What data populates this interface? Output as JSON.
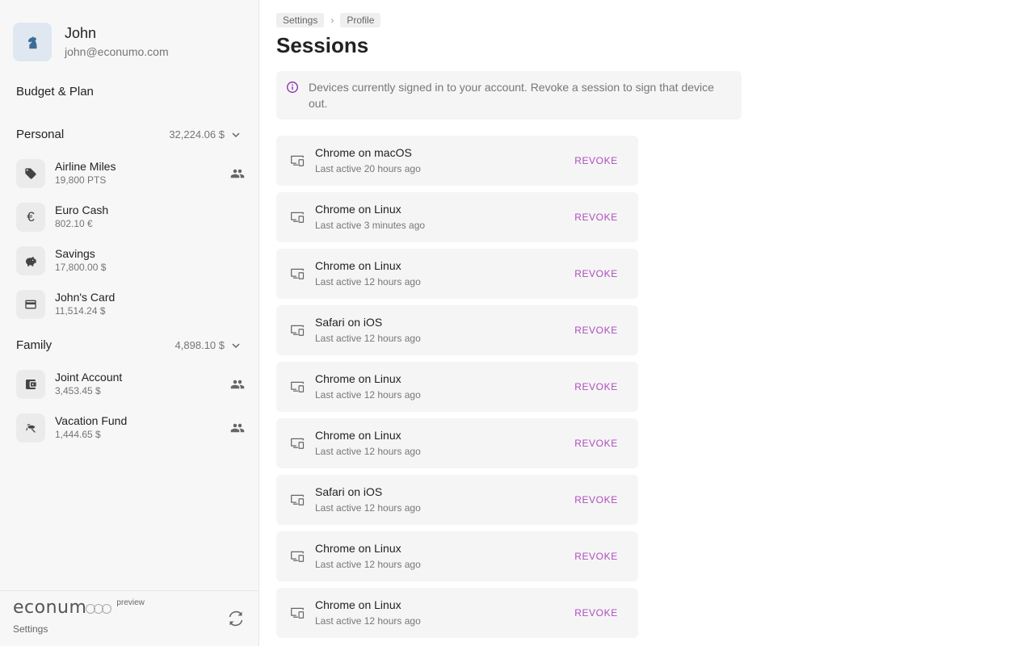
{
  "user": {
    "name": "John",
    "email": "john@econumo.com"
  },
  "sidebar": {
    "budget_label": "Budget & Plan",
    "groups": [
      {
        "name": "Personal",
        "total": "32,224.06 $",
        "accounts": [
          {
            "name": "Airline Miles",
            "balance": "19,800 PTS",
            "icon": "tag-icon",
            "shared": true
          },
          {
            "name": "Euro Cash",
            "balance": "802.10 €",
            "icon": "euro-icon",
            "shared": false
          },
          {
            "name": "Savings",
            "balance": "17,800.00 $",
            "icon": "piggy-bank-icon",
            "shared": false
          },
          {
            "name": "John's Card",
            "balance": "11,514.24 $",
            "icon": "credit-card-icon",
            "shared": false
          }
        ]
      },
      {
        "name": "Family",
        "total": "4,898.10 $",
        "accounts": [
          {
            "name": "Joint Account",
            "balance": "3,453.45 $",
            "icon": "wallet-icon",
            "shared": true
          },
          {
            "name": "Vacation Fund",
            "balance": "1,444.65 $",
            "icon": "beach-umbrella-icon",
            "shared": true
          }
        ]
      }
    ],
    "footer": {
      "logo": "econum",
      "badge": "preview",
      "settings_label": "Settings"
    }
  },
  "breadcrumb": [
    "Settings",
    "Profile"
  ],
  "page_title": "Sessions",
  "info": {
    "text": "Devices currently signed in to your account. Revoke a session to sign that device out."
  },
  "revoke_label": "REVOKE",
  "sessions": [
    {
      "device": "Chrome on macOS",
      "last_active": "Last active 20 hours ago"
    },
    {
      "device": "Chrome on Linux",
      "last_active": "Last active 3 minutes ago"
    },
    {
      "device": "Chrome on Linux",
      "last_active": "Last active 12 hours ago"
    },
    {
      "device": "Safari on iOS",
      "last_active": "Last active 12 hours ago"
    },
    {
      "device": "Chrome on Linux",
      "last_active": "Last active 12 hours ago"
    },
    {
      "device": "Chrome on Linux",
      "last_active": "Last active 12 hours ago"
    },
    {
      "device": "Safari on iOS",
      "last_active": "Last active 12 hours ago"
    },
    {
      "device": "Chrome on Linux",
      "last_active": "Last active 12 hours ago"
    },
    {
      "device": "Chrome on Linux",
      "last_active": "Last active 12 hours ago"
    }
  ],
  "colors": {
    "accent": "#b04cc0",
    "info_icon": "#8e24aa",
    "avatar_bg": "#dfe8f1",
    "avatar_fg": "#3d6b95"
  }
}
